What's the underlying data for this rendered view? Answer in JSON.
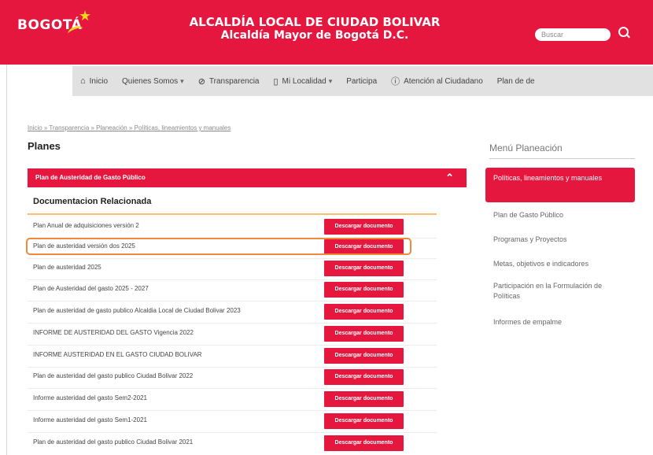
{
  "header": {
    "logo_text": "BOGOTÁ",
    "title_line1": "ALCALDÍA LOCAL DE CIUDAD BOLIVAR",
    "title_line2": "Alcaldía Mayor de Bogotá D.C.",
    "search_placeholder": "Buscar",
    "brand_color": "#e5173f",
    "accent_color": "#f7d21e"
  },
  "nav": {
    "items": [
      {
        "label": "Inicio",
        "icon": "home-icon"
      },
      {
        "label": "Quienes Somos",
        "has_caret": true
      },
      {
        "label": "Transparencia",
        "icon": "shield-check-icon"
      },
      {
        "label": "Mi Localidad",
        "icon": "book-icon",
        "has_caret": true
      },
      {
        "label": "Participa"
      },
      {
        "label": "Atención al Ciudadano",
        "icon": "info-icon"
      },
      {
        "label": "Plan de de"
      }
    ]
  },
  "breadcrumb": "Inicio » Transparencia » Planeación » Políticas, lineamientos y manuales",
  "page_title": "Planes",
  "accordion_title": "Plan de Austeridad de Gasto Público",
  "doc_heading": "Documentacion Relacionada",
  "download_label": "Descargar documento",
  "documents": [
    "Plan Anual de adquisiciones versión 2",
    "Plan de austeridad versión dos 2025",
    "Plan de austeridad 2025",
    "Plan de Austeridad del gasto 2025 - 2027",
    "Plan de austeridad de gasto publico Alcaldia Local de Ciudad Bolivar 2023",
    "INFORME DE AUSTERIDAD DEL GASTO Vigencia 2022",
    "INFORME AUSTERIDAD EN EL GASTO CIUDAD BOLIVAR",
    "Plan de austeridad del gasto publico Ciudad Bolivar 2022",
    "Informe austeridad del gasto Sem2-2021",
    "Informe austeridad del gasto Sem1-2021",
    "Plan de austeridad del gasto publico Ciudad Bolivar 2021"
  ],
  "side_menu": {
    "title": "Menú Planeación",
    "active": "Políticas, lineamientos y manuales",
    "items": [
      "Plan de Gasto Público",
      "Programas y Proyectos",
      "Metas, objetivos e indicadores",
      "Participación en la Formulación de Políticas",
      "Informes de empalme"
    ]
  },
  "highlight_color": "#f08a3a"
}
